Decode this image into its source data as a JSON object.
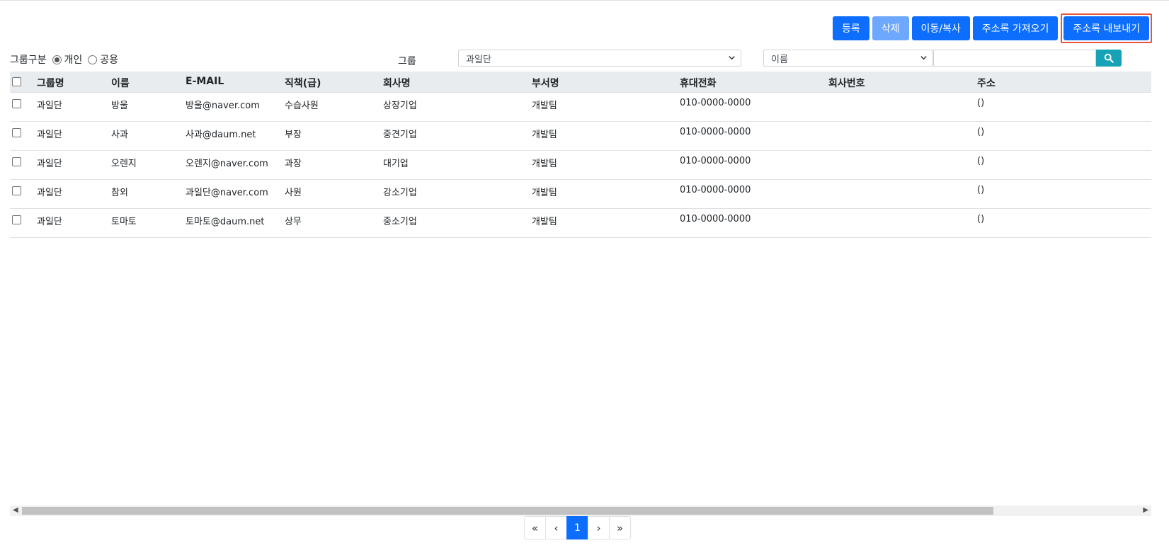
{
  "toolbar": {
    "register": "등록",
    "delete": "삭제",
    "move_copy": "이동/복사",
    "import": "주소록 가져오기",
    "export": "주소록 내보내기"
  },
  "filters": {
    "group_type_label": "그룹구분",
    "radio_personal": "개인",
    "radio_public": "공용",
    "radio_selected": "개인",
    "group_label": "그룹",
    "group_selected": "과일단",
    "search_field_selected": "이름",
    "search_value": ""
  },
  "table": {
    "headers": [
      "그룹명",
      "이름",
      "E-MAIL",
      "직책(급)",
      "회사명",
      "부서명",
      "휴대전화",
      "회사번호",
      "주소"
    ],
    "rows": [
      [
        "과일단",
        "방울",
        "방울@naver.com",
        "수습사원",
        "상장기업",
        "개발팀",
        "010-0000-0000",
        "",
        "()"
      ],
      [
        "과일단",
        "사과",
        "사과@daum.net",
        "부장",
        "중견기업",
        "개발팀",
        "010-0000-0000",
        "",
        "()"
      ],
      [
        "과일단",
        "오렌지",
        "오렌지@naver.com",
        "과장",
        "대기업",
        "개발팀",
        "010-0000-0000",
        "",
        "()"
      ],
      [
        "과일단",
        "참외",
        "과일단@naver.com",
        "사원",
        "강소기업",
        "개발팀",
        "010-0000-0000",
        "",
        "()"
      ],
      [
        "과일단",
        "토마토",
        "토마토@daum.net",
        "상무",
        "중소기업",
        "개발팀",
        "010-0000-0000",
        "",
        "()"
      ]
    ]
  },
  "pagination": {
    "first": "«",
    "prev": "‹",
    "current": "1",
    "next": "›",
    "last": "»"
  },
  "icons": {
    "search": "search-icon",
    "chevron": "chevron-down-icon"
  },
  "colors": {
    "primary": "#0d6efd",
    "primary_disabled": "#6ea8fe",
    "search_button": "#17a2b8",
    "highlight": "#e8553a"
  }
}
